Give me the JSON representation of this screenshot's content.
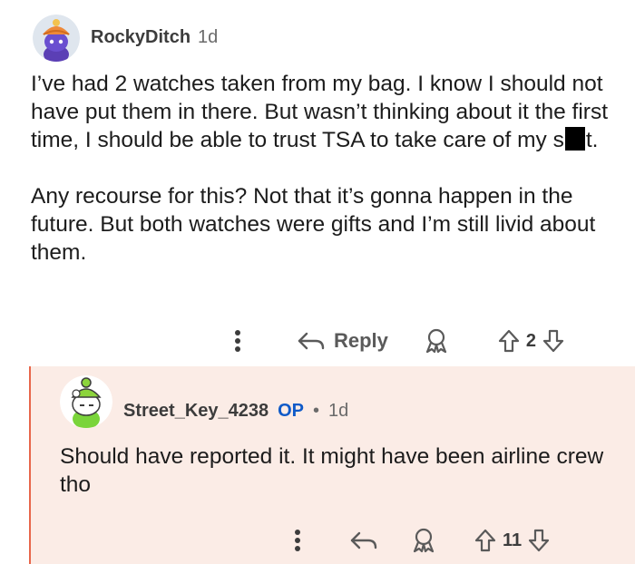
{
  "comment1": {
    "username": "RockyDitch",
    "time": "1d",
    "paragraph1_a": "I’ve had 2 watches taken from my bag. I know I should not have put them in there. But wasn’t thinking about it the first time, I should be able to trust TSA to take care of my s",
    "paragraph1_b": "t.",
    "paragraph2": "Any recourse for this? Not that it’s gonna happen in the future. But both watches were gifts and I’m still livid about them.",
    "reply_label": "Reply",
    "vote_count": "2"
  },
  "comment2": {
    "username": "Street_Key_4238",
    "op_badge": "OP",
    "separator": "•",
    "time": "1d",
    "text": "Should have reported it. It might have been airline crew tho",
    "vote_count": "11"
  },
  "colors": {
    "reply_bg": "#fbece6",
    "thread_line": "#e8664a",
    "op_blue": "#0f5ac8"
  },
  "icons": {
    "more": "more-vertical-icon",
    "reply": "reply-arrow-icon",
    "award": "award-icon",
    "upvote": "upvote-arrow-icon",
    "downvote": "downvote-arrow-icon"
  }
}
